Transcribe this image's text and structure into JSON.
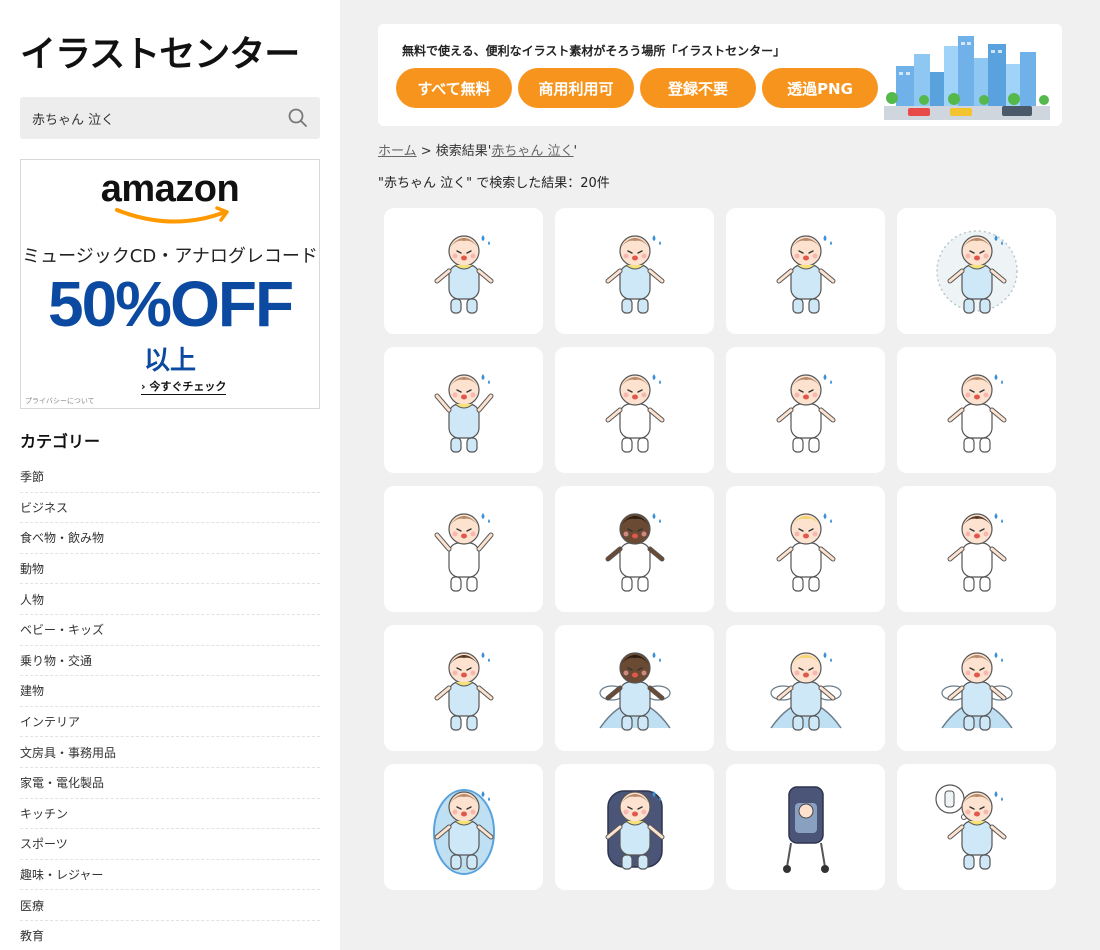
{
  "site": {
    "logo": "イラストセンター"
  },
  "search": {
    "value": "赤ちゃん 泣く",
    "placeholder": ""
  },
  "ad": {
    "logo": "amazon",
    "subtitle": "ミュージックCD・アナログレコード",
    "headline": "50%OFF",
    "headline2": "以上",
    "cta": "今すぐチェック",
    "privacy": "プライバシーについて",
    "colors": {
      "accent": "#ff9900",
      "headline": "#0b4aa0"
    }
  },
  "sidebar": {
    "title": "カテゴリー",
    "categories": [
      "季節",
      "ビジネス",
      "食べ物・飲み物",
      "動物",
      "人物",
      "ベビー・キッズ",
      "乗り物・交通",
      "建物",
      "インテリア",
      "文房具・事務用品",
      "家電・電化製品",
      "キッチン",
      "スポーツ",
      "趣味・レジャー",
      "医療",
      "教育"
    ]
  },
  "banner": {
    "text": "無料で使える、便利なイラスト素材がそろう場所「イラストセンター」",
    "tags": [
      "すべて無料",
      "商用利用可",
      "登録不要",
      "透過PNG"
    ],
    "tag_color": "#f7941d"
  },
  "breadcrumb": {
    "home": "ホーム",
    "sep": " > ",
    "prefix": "検索結果'",
    "query": "赤ちゃん 泣く",
    "suffix": "'"
  },
  "results": {
    "summary": "\"赤ちゃん 泣く\" で検索した結果：20件"
  },
  "illustrations": [
    {
      "variant": "standing-blue"
    },
    {
      "variant": "sitting-blue"
    },
    {
      "variant": "sitting-blue"
    },
    {
      "variant": "on-blanket"
    },
    {
      "variant": "arms-up-blue"
    },
    {
      "variant": "diaper-standing"
    },
    {
      "variant": "diaper-sitting"
    },
    {
      "variant": "diaper-sitting"
    },
    {
      "variant": "diaper-arms-up"
    },
    {
      "variant": "dark-skin-diaper"
    },
    {
      "variant": "blond-diaper"
    },
    {
      "variant": "dark-hair-diaper"
    },
    {
      "variant": "flat-blue"
    },
    {
      "variant": "changing-dark"
    },
    {
      "variant": "changing-blond"
    },
    {
      "variant": "changing"
    },
    {
      "variant": "bassinet"
    },
    {
      "variant": "car-seat"
    },
    {
      "variant": "stroller"
    },
    {
      "variant": "thinking-bottle"
    }
  ]
}
